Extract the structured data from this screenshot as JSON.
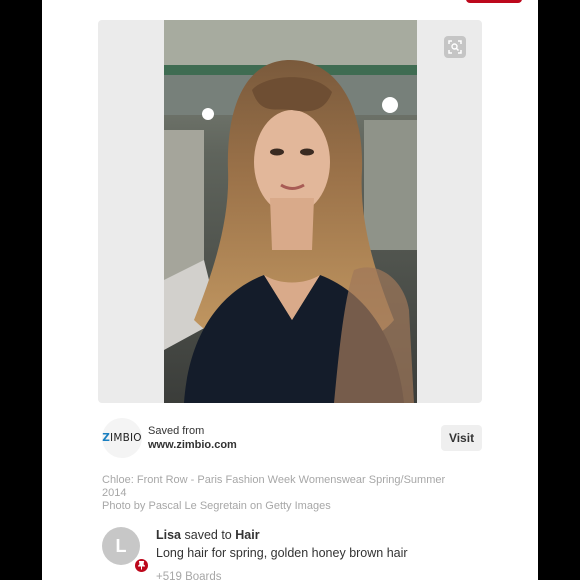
{
  "pin": {
    "source_prefix": "Saved from",
    "source_url": "www.zimbio.com",
    "source_logo": {
      "mark": "Z",
      "rest": "IMBIO"
    },
    "visit_label": "Visit",
    "caption_line1": "Chloe: Front Row - Paris Fashion Week Womenswear Spring/Summer",
    "caption_line2": "2014",
    "caption_line3": "Photo by Pascal Le Segretain on Getty Images"
  },
  "saver": {
    "avatar_letter": "L",
    "name": "Lisa",
    "saved_to_text": "saved to",
    "board": "Hair",
    "description": "Long hair for spring, golden honey brown hair",
    "boards_count": "+519 Boards"
  },
  "colors": {
    "accent_red": "#bd081c",
    "zimbio_blue": "#1a7fc1",
    "caption_gray": "#a7a7a7"
  },
  "icons": {
    "zoom": "visual-search-icon",
    "badge": "pin-icon"
  }
}
